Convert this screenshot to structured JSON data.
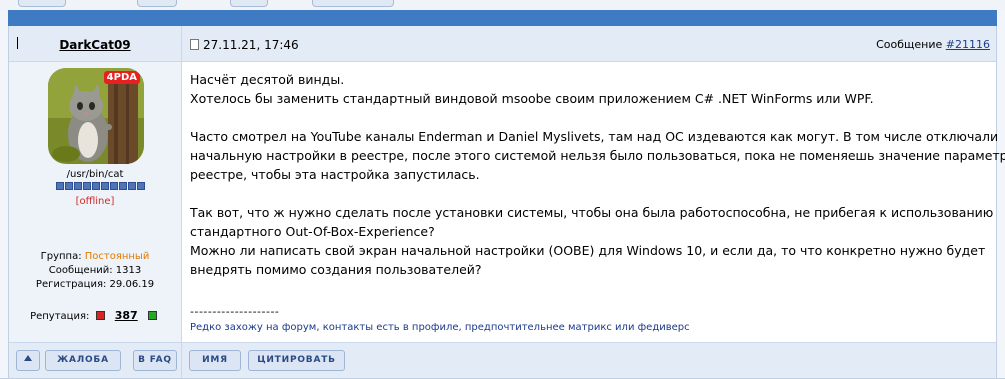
{
  "post": {
    "author": "DarkCat09",
    "date": "27.11.21, 17:46",
    "message_label": "Сообщение",
    "message_number": "#21116",
    "user": {
      "avatar_badge": "4PDA",
      "title": "/usr/bin/cat",
      "status": "[offline]",
      "group_label": "Группа:",
      "group_value": "Постоянный",
      "messages_label": "Сообщений:",
      "messages_value": "1313",
      "registration_label": "Регистрация:",
      "registration_value": "29.06.19",
      "reputation_label": "Репутация:",
      "reputation_value": "387"
    },
    "body": [
      "Насчёт десятой винды.",
      "Хотелось бы заменить стандартный виндовой msoobe своим приложением C# .NET WinForms или WPF.",
      "Часто смотрел на YouTube каналы Enderman и Daniel Myslivets, там над ОС издеваются как могут. В том числе отключали",
      "начальную настройки в реестре, после этого системой нельзя было пользоваться, пока не поменяешь значение параметра в",
      "реестре, чтобы эта настройка запустилась.",
      "Так вот, что ж нужно сделать после установки системы, чтобы она была работоспособна, не прибегая к использованию",
      "стандартного Out-Of-Box-Experience?",
      "Можно ли написать свой экран начальной настройки (OOBE) для Windows 10, и если да, то что конкретно нужно будет",
      "внедрять помимо создания пользователей?"
    ],
    "signature_line": "--------------------",
    "signature": "Редко захожу на форум, контакты есть в профиле, предпочтительнее матрикс или федиверс"
  },
  "buttons": {
    "complaint": "ЖАЛОБА",
    "faq": "В FAQ",
    "name": "ИМЯ",
    "quote": "ЦИТИРОВАТЬ"
  },
  "colors": {
    "top_bar": "#3f7bc3",
    "header_bg": "#e3ebf6",
    "offline": "#d02a2a",
    "group_value": "#e07a00",
    "signature": "#1b3a8c"
  }
}
